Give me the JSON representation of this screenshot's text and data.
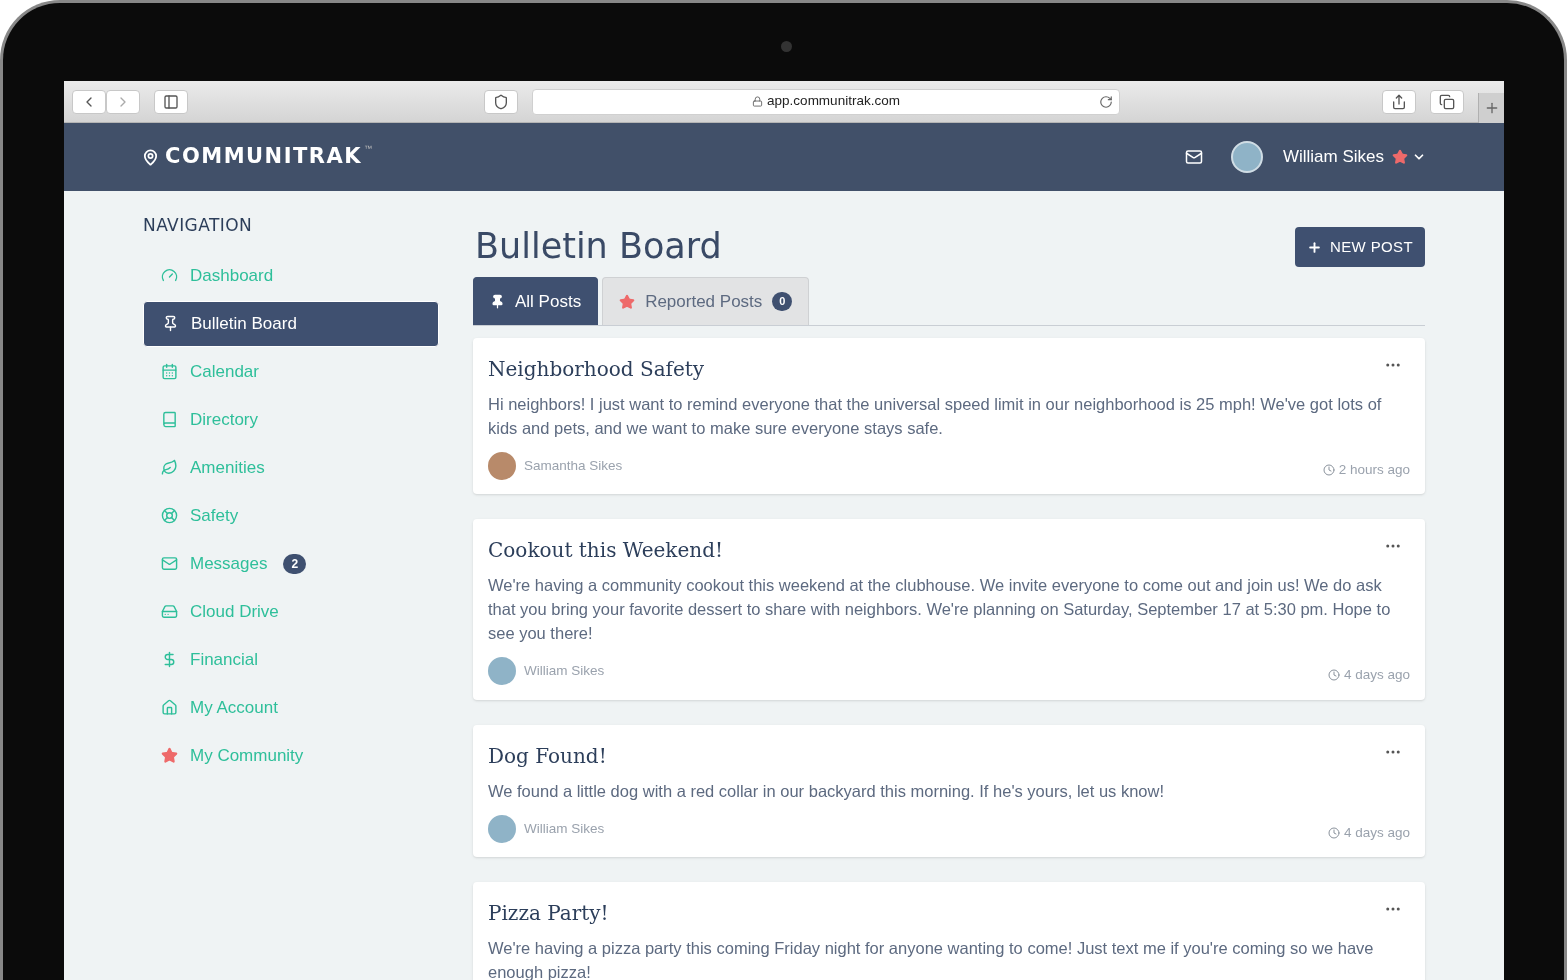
{
  "browser": {
    "url": "app.communitrak.com"
  },
  "header": {
    "logo": "COMMUNITRAK",
    "trademark": "™",
    "user_name": "William Sikes"
  },
  "navigation": {
    "heading": "NAVIGATION",
    "items": [
      {
        "label": "Dashboard",
        "selected": false
      },
      {
        "label": "Bulletin Board",
        "selected": true
      },
      {
        "label": "Calendar",
        "selected": false
      },
      {
        "label": "Directory",
        "selected": false
      },
      {
        "label": "Amenities",
        "selected": false
      },
      {
        "label": "Safety",
        "selected": false
      },
      {
        "label": "Messages",
        "selected": false,
        "badge": "2"
      },
      {
        "label": "Cloud Drive",
        "selected": false
      },
      {
        "label": "Financial",
        "selected": false
      },
      {
        "label": "My Account",
        "selected": false
      },
      {
        "label": "My Community",
        "selected": false
      }
    ]
  },
  "page": {
    "title": "Bulletin Board",
    "new_post_button": "NEW POST"
  },
  "tabs": [
    {
      "label": "All Posts",
      "selected": true
    },
    {
      "label": "Reported Posts",
      "selected": false,
      "badge": "0"
    }
  ],
  "posts": [
    {
      "title": "Neighborhood Safety",
      "body": "Hi neighbors! I just want to remind everyone that the universal speed limit in our neighborhood is 25 mph! We've got lots of kids and pets, and we want to make sure everyone stays safe.",
      "author": "Samantha Sikes",
      "time": "2 hours ago"
    },
    {
      "title": "Cookout this Weekend!",
      "body": "We're having a community cookout this weekend at the clubhouse. We invite everyone to come out and join us! We do ask that you bring your favorite dessert to share with neighbors. We're planning on Saturday, September 17 at 5:30 pm. Hope to see you there!",
      "author": "William Sikes",
      "time": "4 days ago"
    },
    {
      "title": "Dog Found!",
      "body": "We found a little dog with a red collar in our backyard this morning. If he's yours, let us know!",
      "author": "William Sikes",
      "time": "4 days ago"
    },
    {
      "title": "Pizza Party!",
      "body": "We're having a pizza party this coming Friday night for anyone wanting to come! Just text me if you're coming so we have enough pizza!"
    }
  ]
}
